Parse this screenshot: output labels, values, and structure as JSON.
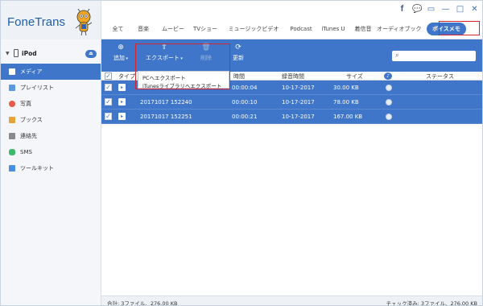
{
  "app": {
    "name": "FoneTrans"
  },
  "window_controls": [
    "f",
    "💬",
    "▭",
    "—",
    "□",
    "✕"
  ],
  "categories": [
    "全て",
    "音楽",
    "ムービー",
    "TVショー",
    "ミュージックビデオ",
    "Podcast",
    "iTunes U",
    "着信音",
    "オーディオブック",
    "ボイスメモ"
  ],
  "active_category": "ボイスメモ",
  "device": {
    "name": "iPod"
  },
  "sidebar": {
    "items": [
      {
        "label": "メディア",
        "color": "#ffffff"
      },
      {
        "label": "プレイリスト",
        "color": "#5a9be0"
      },
      {
        "label": "写真",
        "color": "#e85b4a"
      },
      {
        "label": "ブックス",
        "color": "#e7a23a"
      },
      {
        "label": "連絡先",
        "color": "#8a8a8a"
      },
      {
        "label": "SMS",
        "color": "#3cb86a"
      },
      {
        "label": "ツールキット",
        "color": "#4a8fe0"
      }
    ]
  },
  "toolbar": {
    "add_label": "追加",
    "export_label": "エクスポート",
    "delete_label": "削除",
    "refresh_label": "更新"
  },
  "export_menu": {
    "items": [
      "PCへエクスポート",
      "iTunesライブラリへエクスポート"
    ]
  },
  "table": {
    "headers": [
      "タイプ",
      "時間",
      "録音時間",
      "サイズ",
      "ステータス"
    ],
    "rows": [
      {
        "name": "",
        "time": "00:00:04",
        "date": "10-17-2017",
        "size": "30.00 KB"
      },
      {
        "name": "20171017 152240",
        "time": "00:00:10",
        "date": "10-17-2017",
        "size": "78.00 KB"
      },
      {
        "name": "20171017 152251",
        "time": "00:00:21",
        "date": "10-17-2017",
        "size": "167.00 KB"
      }
    ]
  },
  "footer": {
    "left": "合計: 3ファイル、276.00 KB",
    "right": "チェック済み: 3ファイル、276.00 KB"
  },
  "colors": {
    "accent": "#3f76c9",
    "highlight_border": "#d6252c"
  }
}
